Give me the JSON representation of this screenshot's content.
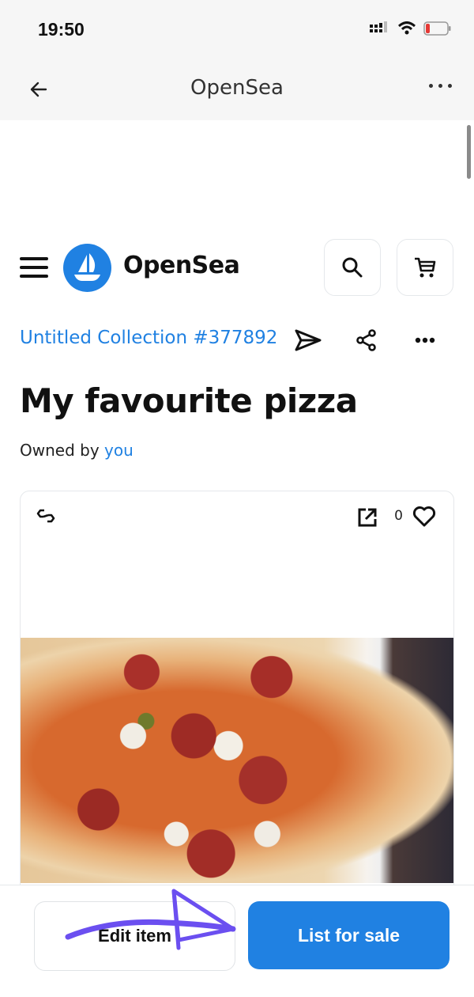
{
  "status_bar": {
    "time": "19:50",
    "icons": [
      "cellular-signal-icon",
      "wifi-icon",
      "battery-low-icon"
    ],
    "battery_color": "#e53935"
  },
  "nav_bar": {
    "title": "OpenSea",
    "back_icon": "arrow-left-icon",
    "more_icon": "more-horizontal-icon"
  },
  "site_header": {
    "brand": "OpenSea",
    "brand_color": "#2081e2",
    "menu_icon": "hamburger-menu-icon",
    "search_icon": "search-icon",
    "cart_icon": "cart-icon"
  },
  "item": {
    "collection": "Untitled Collection #377892",
    "title": "My favourite pizza",
    "owned_by_label": "Owned by",
    "owner": "you",
    "favorites_count": "0",
    "chain_icon": "polygon-chain-icon",
    "image_alt": "Pepperoni pizza photo"
  },
  "actions": {
    "transfer_icon": "send-icon",
    "share_icon": "share-icon",
    "more_icon": "more-horizontal-icon"
  },
  "footer": {
    "edit_label": "Edit item",
    "list_label": "List for sale"
  },
  "annotation": {
    "color": "#6b4ff0",
    "type": "arrow"
  }
}
